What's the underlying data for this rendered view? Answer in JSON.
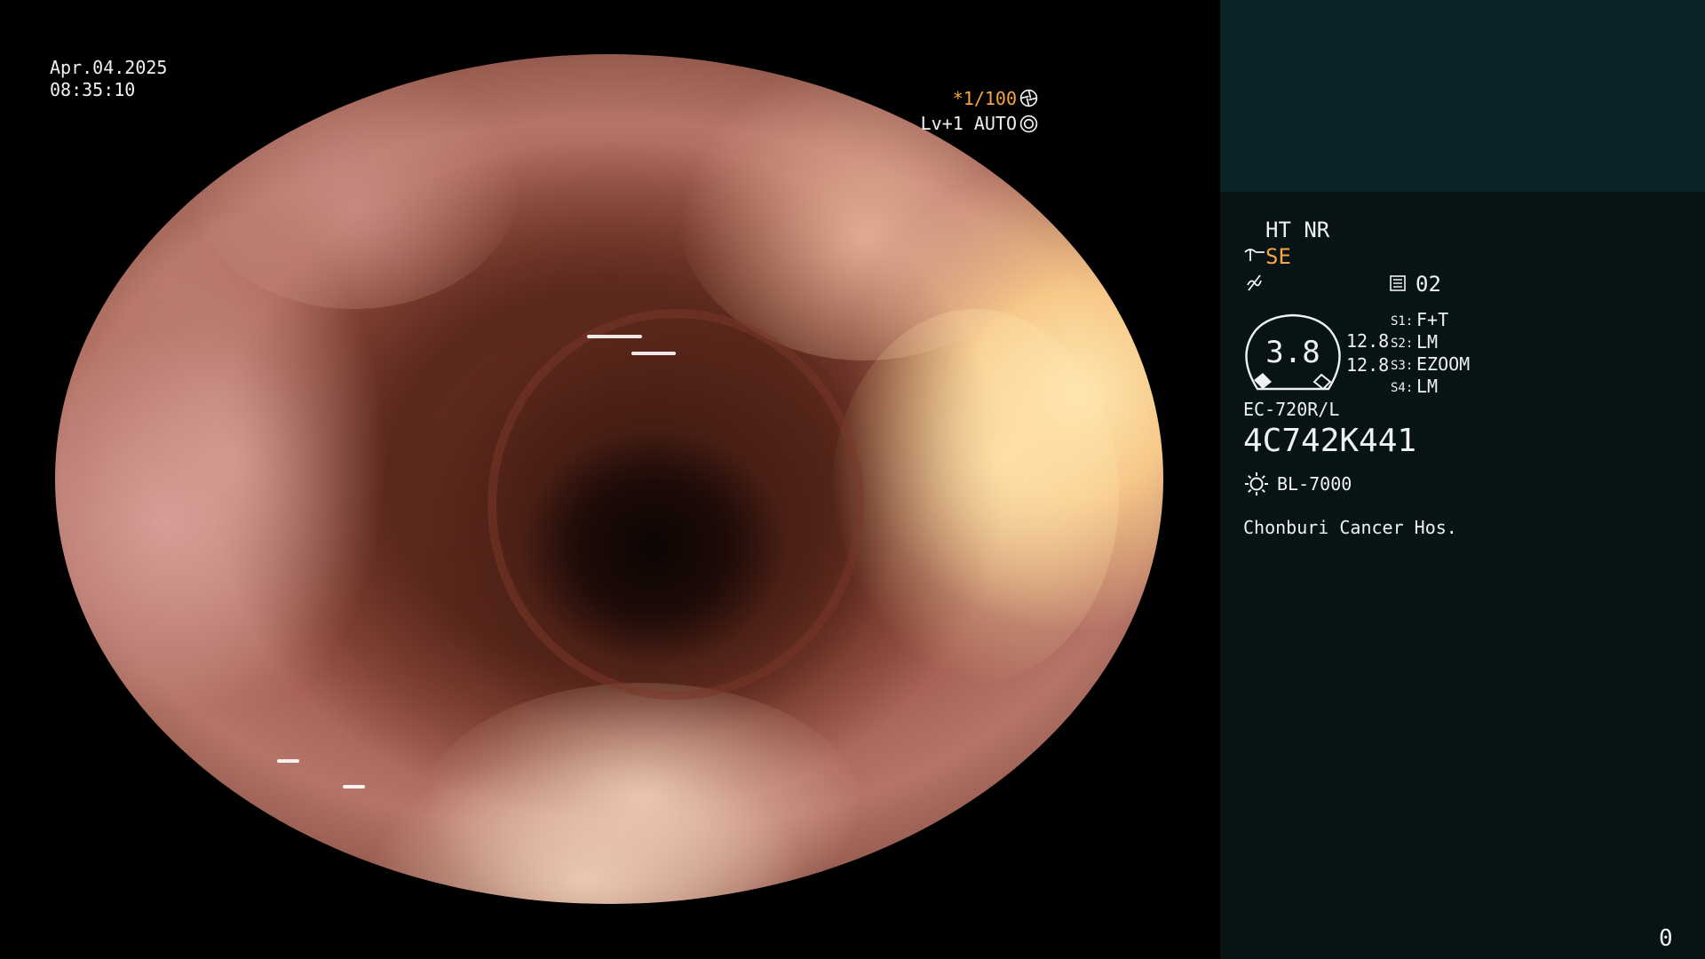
{
  "overlay": {
    "date": "Apr.04.2025",
    "time": "08:35:10",
    "shutter": "*1/100",
    "level": "Lv+1 AUTO"
  },
  "panel": {
    "ht_nr": "HT NR",
    "enhancement": "SE",
    "doc_number": "02",
    "gauge_value": "3.8",
    "value_1": "12.8",
    "value_2": "12.8",
    "switches": [
      {
        "label": "S1:",
        "value": "F+T"
      },
      {
        "label": "S2:",
        "value": "LM"
      },
      {
        "label": "S3:",
        "value": "EZOOM"
      },
      {
        "label": "S4:",
        "value": "LM"
      }
    ],
    "scope_model": "EC-720R/L",
    "serial": "4C742K441",
    "light_source": "BL-7000",
    "hospital": "Chonburi Cancer Hos.",
    "counter": "0"
  },
  "colors": {
    "accent_orange": "#f5a642",
    "panel_top": "#0b2326",
    "panel_bg": "#071314"
  },
  "icons": [
    "shutter-icon",
    "auto-icon",
    "se-icon",
    "freeze-icon",
    "document-icon",
    "light-source-icon"
  ]
}
